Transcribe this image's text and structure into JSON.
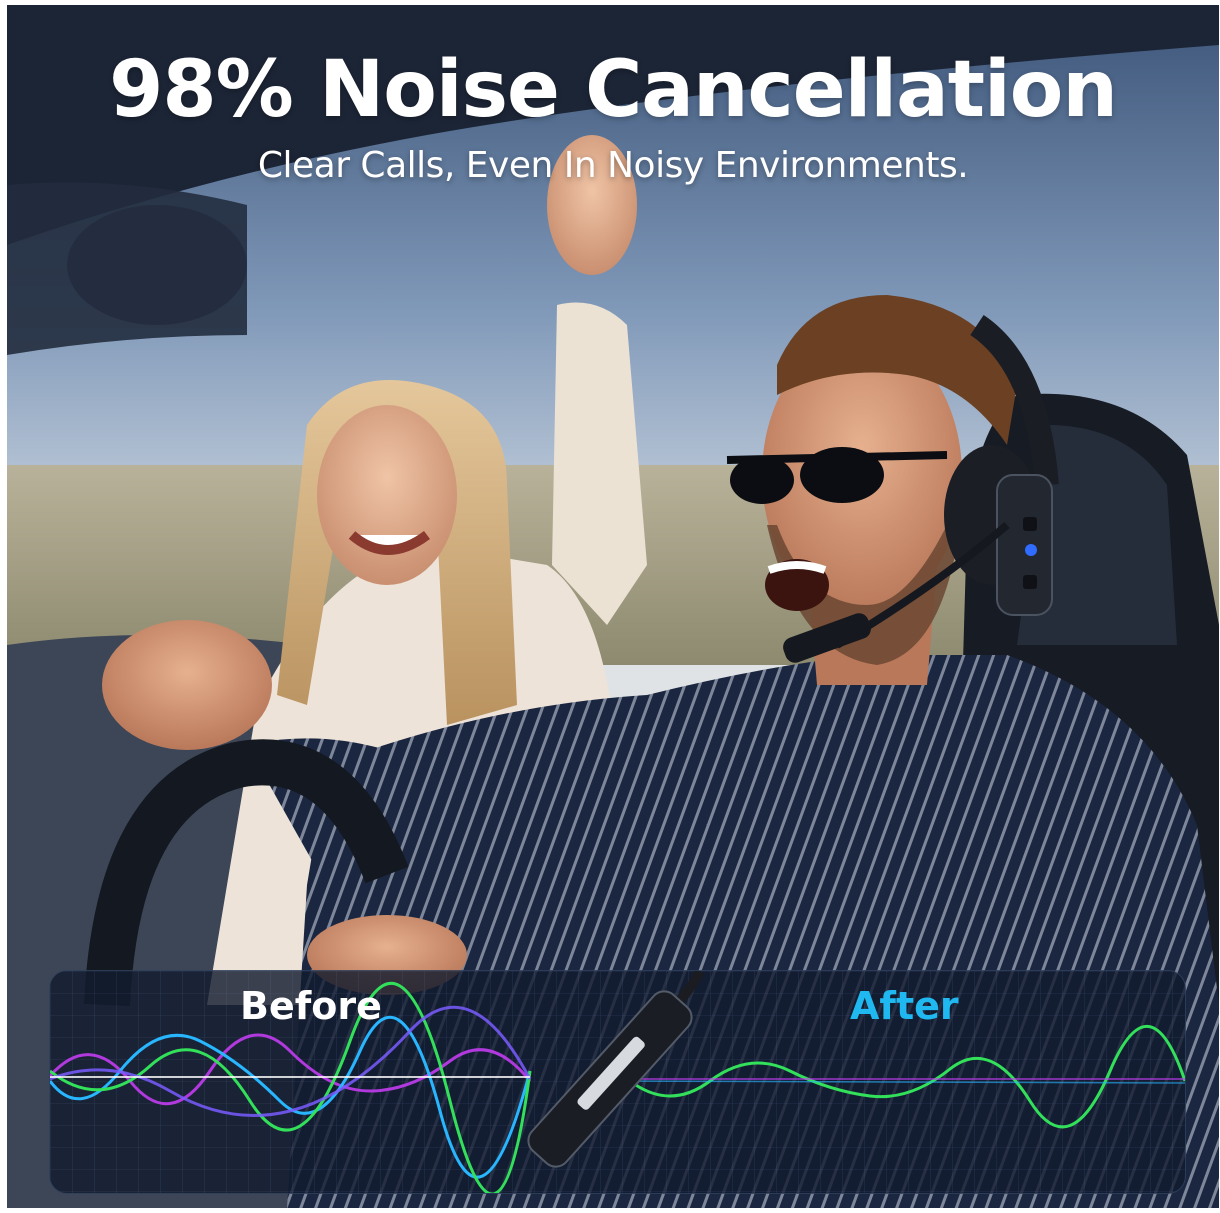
{
  "headline": "98%  Noise Cancellation",
  "subheadline": "Clear Calls, Even In Noisy Environments.",
  "comparison": {
    "before_label": "Before",
    "after_label": "After"
  },
  "colors": {
    "headline_text": "#ffffff",
    "after_accent": "#1fb8f0",
    "wave_green": "#32e05a",
    "wave_blue": "#28b6ff",
    "wave_purple": "#c23cf0",
    "panel_bg": "#121c30"
  },
  "icons": {
    "product": "headset-microphone-boom-icon"
  }
}
